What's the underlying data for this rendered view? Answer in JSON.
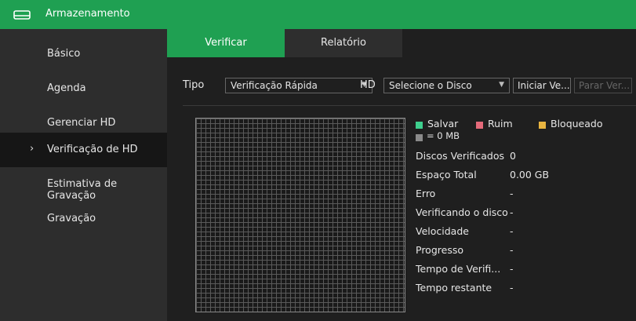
{
  "header": {
    "title": "Armazenamento",
    "icon": "hdd-icon"
  },
  "sidebar": {
    "items": [
      {
        "label": "Básico"
      },
      {
        "label": "Agenda"
      },
      {
        "label": "Gerenciar HD"
      },
      {
        "label": "Verificação de HD",
        "active": true
      },
      {
        "label": "Estimativa de Gravação"
      },
      {
        "label": "Gravação"
      }
    ],
    "active_marker": "›"
  },
  "tabs": [
    {
      "label": "Verificar",
      "active": true
    },
    {
      "label": "Relatório",
      "active": false
    }
  ],
  "controls": {
    "tipo_label": "Tipo",
    "tipo_value": "Verificação Rápida",
    "hd_label": "HD",
    "hd_value": "Selecione o Disco",
    "start_button": "Iniciar Ve...",
    "stop_button": "Parar Ver..."
  },
  "legend": {
    "salvar": "Salvar",
    "ruim": "Ruim",
    "bloqueado": "Bloqueado",
    "block_size": "= 0 MB"
  },
  "info": {
    "discos_verificados_label": "Discos Verificados",
    "discos_verificados_value": "0",
    "espaco_total_label": "Espaço Total",
    "espaco_total_value": "0.00 GB",
    "erro_label": "Erro",
    "erro_value": "-",
    "verificando_label": "Verificando o disco",
    "verificando_value": "-",
    "velocidade_label": "Velocidade",
    "velocidade_value": "-",
    "progresso_label": "Progresso",
    "progresso_value": "-",
    "tempo_verif_label": "Tempo de Verifi...",
    "tempo_verif_value": "-",
    "tempo_restante_label": "Tempo restante",
    "tempo_restante_value": "-"
  },
  "colors": {
    "accent": "#1fa052",
    "salvar": "#3ecf8e",
    "ruim": "#e46a7a",
    "bloqueado": "#e8b440",
    "block": "#8a8a8a"
  }
}
